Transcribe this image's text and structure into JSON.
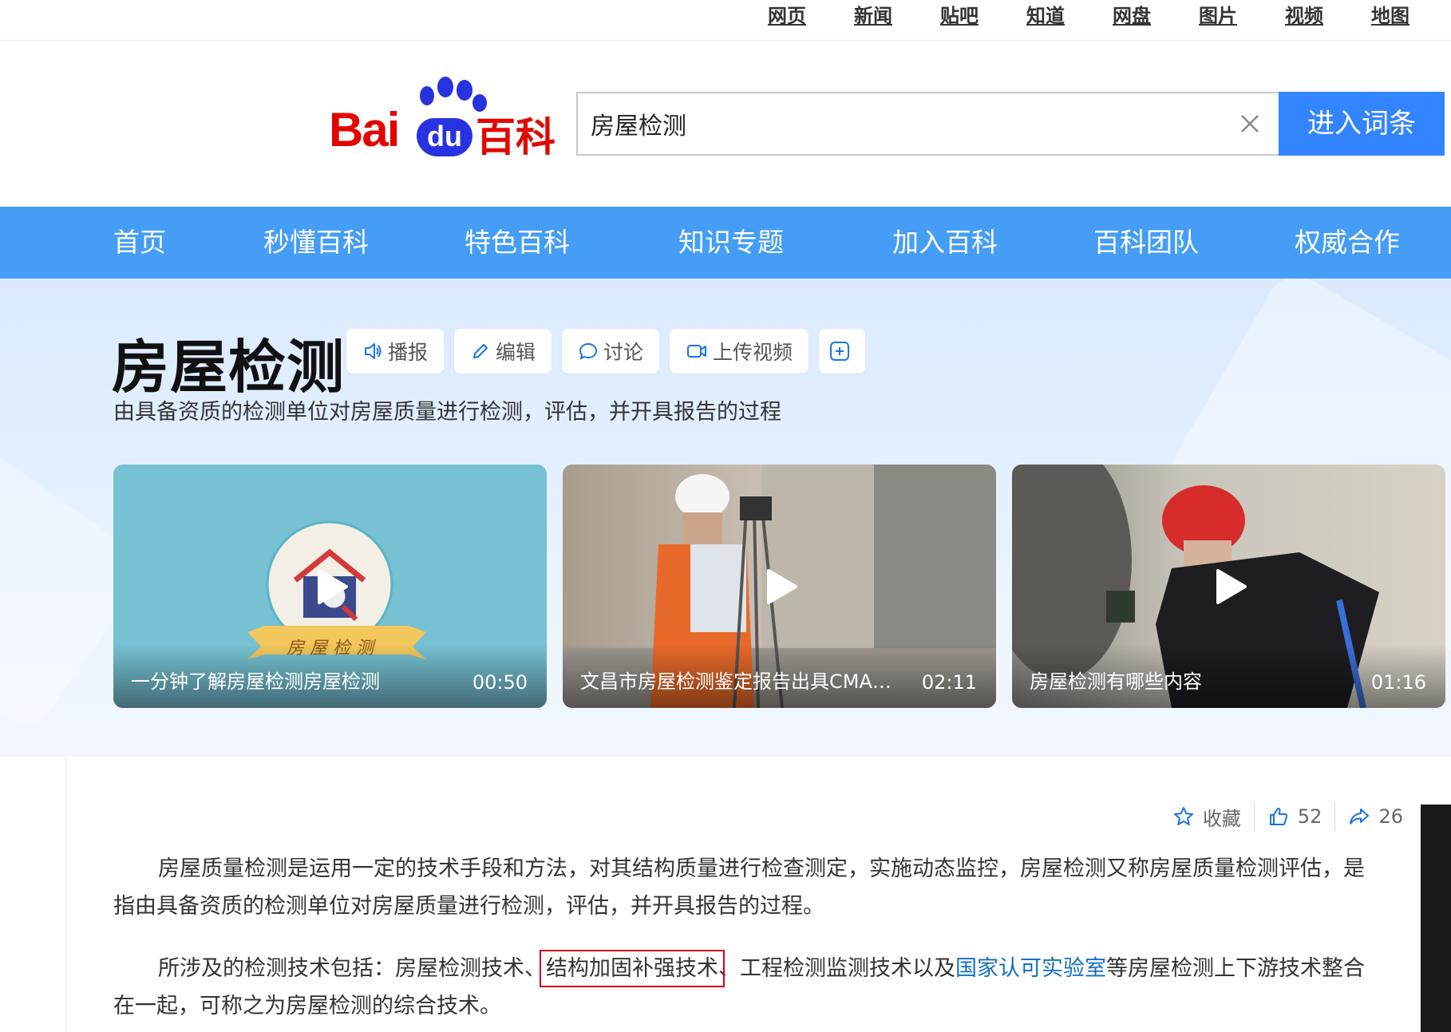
{
  "top_links": [
    "网页",
    "新闻",
    "贴吧",
    "知道",
    "网盘",
    "图片",
    "视频",
    "地图"
  ],
  "logo": {
    "bai": "Bai",
    "du": "du",
    "baike": "百科"
  },
  "search": {
    "value": "房屋检测",
    "button": "进入词条"
  },
  "nav": [
    "首页",
    "秒懂百科",
    "特色百科",
    "知识专题",
    "加入百科",
    "百科团队",
    "权威合作"
  ],
  "entry": {
    "title": "房屋检测",
    "actions": {
      "broadcast": "播报",
      "edit": "编辑",
      "discuss": "讨论",
      "upload_video": "上传视频"
    },
    "subtitle": "由具备资质的检测单位对房屋质量进行检测，评估，并开具报告的过程"
  },
  "videos": [
    {
      "title": "一分钟了解房屋检测房屋检测",
      "duration": "00:50",
      "banner": "房 屋 检 测"
    },
    {
      "title": "文昌市房屋检测鉴定报告出具CMA资质...",
      "duration": "02:11"
    },
    {
      "title": "房屋检测有哪些内容",
      "duration": "01:16"
    }
  ],
  "meta": {
    "favorite": "收藏",
    "likes": "52",
    "shares": "26"
  },
  "paragraph1": "房屋质量检测是运用一定的技术手段和方法，对其结构质量进行检查测定，实施动态监控，房屋检测又称房屋质量检测评估，是指由具备资质的检测单位对房屋质量进行检测，评估，并开具报告的过程。",
  "paragraph2": {
    "part1": "所涉及的检测技术包括：房屋检测技术、",
    "highlighted": "结构加固补强技术",
    "part2": "、工程检测监测技术以及",
    "link": "国家认可实验室",
    "part3": "等房屋检测上下游技术整合在一起，可称之为房屋检测的综合技术。"
  },
  "colors": {
    "nav_bg": "#459df5",
    "search_button": "#3385ff",
    "logo_red": "#e10601",
    "logo_blue": "#2932e1",
    "link": "#136ec2",
    "highlight_box": "#d0021b"
  }
}
